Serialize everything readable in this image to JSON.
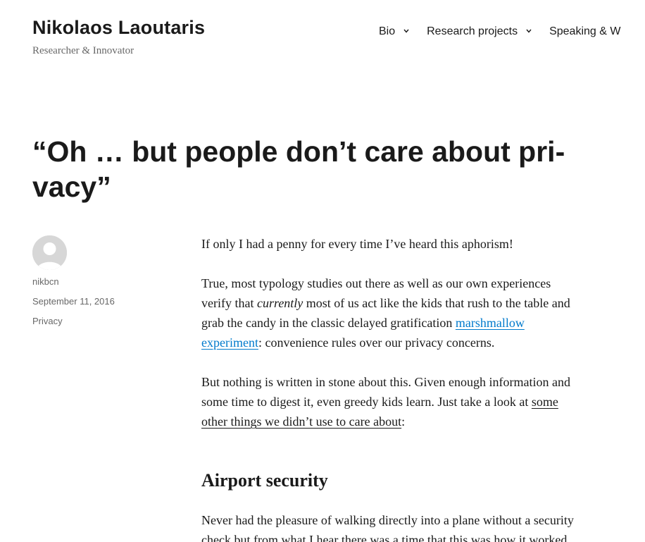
{
  "site": {
    "title": "Nikolaos Laoutaris",
    "tagline": "Researcher & Innovator"
  },
  "nav": {
    "items": [
      {
        "label": "Bio",
        "icon": "chevron-down-icon"
      },
      {
        "label": "Research projects",
        "icon": "chevron-down-icon"
      },
      {
        "label": "Speaking & W"
      }
    ]
  },
  "post": {
    "title_line1": "“Oh … but people don’t care about pri-",
    "title_line2": "vacy”",
    "author": "nikbcn",
    "date": "September 11, 2016",
    "category": "Privacy",
    "avatar_icon": "avatar-icon"
  },
  "content": {
    "p1": "If only I had a penny for every time I’ve heard this aphorism!",
    "p2_l1": "True, most typology studies out there as well as our own experiences",
    "p2_l2_a": "verify that ",
    "p2_l2_em": "currently",
    "p2_l2_b": " most of us act like the kids that rush to the table and",
    "p2_l3_a": "grab the candy in the classic delayed gratification ",
    "p2_l3_link": "marshmallow",
    "p2_l4_link": "experiment",
    "p2_l4_b": ": convenience rules over our privacy concerns.",
    "p3_l1": "But nothing is written in stone about this. Given enough information and",
    "p3_l2_a": "some time to digest it, even greedy kids learn. Just take a look at ",
    "p3_l2_link": "some",
    "p3_l3_link": "other things we didn’t use to care about",
    "p3_l3_b": ":",
    "h2": "Airport security",
    "p4_l1": "Never had the pleasure of walking directly into a plane without a security",
    "p4_l2": "check but from what I hear there was a time that this was how it worked"
  },
  "colors": {
    "text": "#1a1a1a",
    "muted": "#686868",
    "link": "#007acc",
    "avatar": "#d7d7d7"
  }
}
